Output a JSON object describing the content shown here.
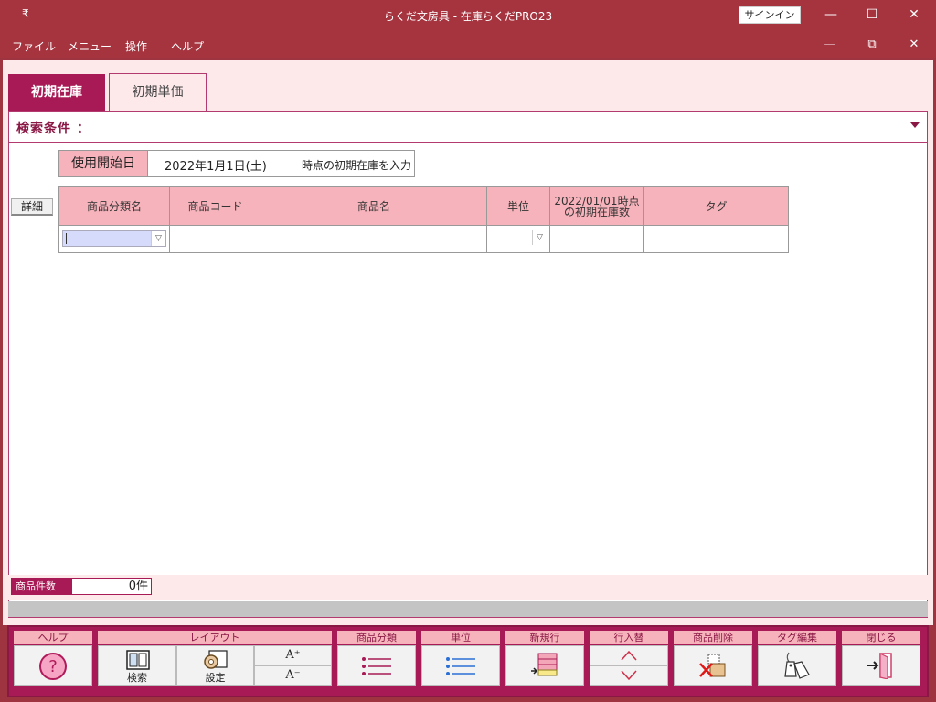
{
  "window": {
    "quick_access_glyph": "₹",
    "title": "らくだ文房具 - 在庫らくだPRO23",
    "signin_label": "サインイン",
    "minimize_glyph": "—",
    "maximize_glyph": "☐",
    "close_glyph": "✕"
  },
  "menubar": {
    "items": [
      "ファイル",
      "メニュー",
      "操作",
      "ヘルプ"
    ],
    "minimize_glyph": "—",
    "restore_glyph": "⧉",
    "close_glyph": "✕"
  },
  "tabs": [
    {
      "label": "初期在庫",
      "active": true
    },
    {
      "label": "初期単価",
      "active": false
    }
  ],
  "search": {
    "label": "検索条件 ："
  },
  "start_date": {
    "label": "使用開始日",
    "value": "2022年1月1日(土)",
    "suffix": "時点の初期在庫を入力"
  },
  "detail_button": "詳細",
  "grid": {
    "columns": [
      "商品分類名",
      "商品コード",
      "商品名",
      "単位",
      "2022/01/01時点の初期在庫数",
      "タグ"
    ]
  },
  "status": {
    "count_label": "商品件数",
    "count_value": "0件"
  },
  "toolbar": {
    "help": {
      "label": "ヘルプ"
    },
    "layout": {
      "label": "レイアウト",
      "search": "検索",
      "settings": "設定",
      "font_up": "A⁺",
      "font_down": "A⁻"
    },
    "category": {
      "label": "商品分類"
    },
    "unit": {
      "label": "単位"
    },
    "new_row": {
      "label": "新規行"
    },
    "reorder": {
      "label": "行入替"
    },
    "delete": {
      "label": "商品削除"
    },
    "tag_edit": {
      "label": "タグ編集"
    },
    "close": {
      "label": "閉じる"
    }
  },
  "colors": {
    "titlebar": "#a5343f",
    "accent": "#a81a55",
    "header_pink": "#f7b3bb",
    "background_pink": "#fde8ea"
  }
}
